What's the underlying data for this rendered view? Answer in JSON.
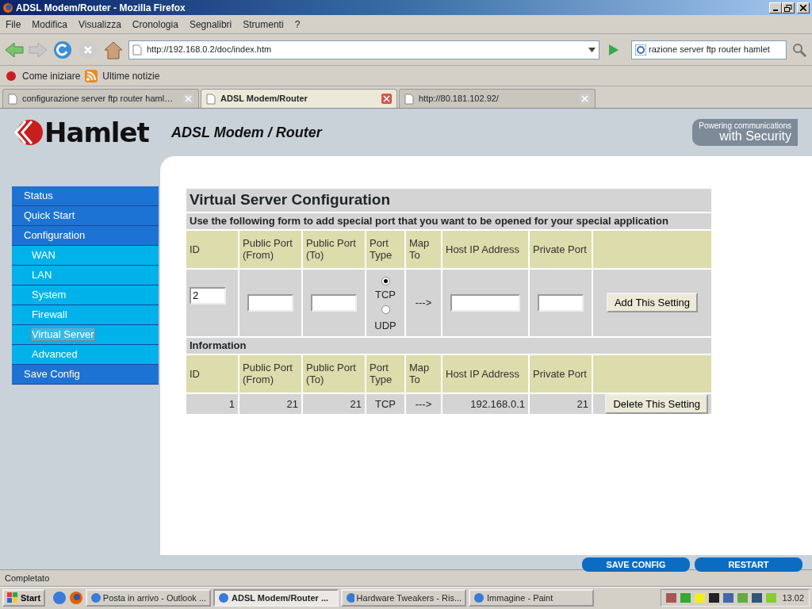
{
  "window": {
    "title": "ADSL Modem/Router - Mozilla Firefox"
  },
  "menu": [
    "File",
    "Modifica",
    "Visualizza",
    "Cronologia",
    "Segnalibri",
    "Strumenti",
    "?"
  ],
  "toolbar": {
    "url": "http://192.168.0.2/doc/index.htm",
    "search": "razione  server ftp router hamlet"
  },
  "bookmarks": [
    "Come iniziare",
    "Ultime notizie"
  ],
  "tabs": [
    {
      "label": "configurazione server ftp router haml…",
      "selected": false
    },
    {
      "label": "ADSL Modem/Router",
      "selected": true
    },
    {
      "label": "http://80.181.102.92/",
      "selected": false
    }
  ],
  "page": {
    "logo": "Hamlet",
    "header": "ADSL Modem / Router",
    "tagline": [
      "Powering communications",
      "with Security"
    ],
    "sidebar": [
      {
        "label": "Status",
        "kind": "main",
        "selected": false
      },
      {
        "label": "Quick Start",
        "kind": "main",
        "selected": false
      },
      {
        "label": "Configuration",
        "kind": "main",
        "selected": false
      },
      {
        "label": "WAN",
        "kind": "sub",
        "selected": false
      },
      {
        "label": "LAN",
        "kind": "sub",
        "selected": false
      },
      {
        "label": "System",
        "kind": "sub",
        "selected": false
      },
      {
        "label": "Firewall",
        "kind": "sub",
        "selected": false
      },
      {
        "label": "Virtual Server",
        "kind": "sub",
        "selected": true
      },
      {
        "label": "Advanced",
        "kind": "sub",
        "selected": false
      },
      {
        "label": "Save Config",
        "kind": "main",
        "selected": false
      }
    ],
    "form": {
      "title": "Virtual Server Configuration",
      "description": "Use the following form to add special port that you want to be opened for your special application",
      "columns": [
        "ID",
        "Public Port (From)",
        "Public Port (To)",
        "Port Type",
        "Map To",
        "Host IP Address",
        "Private Port"
      ],
      "id_value": "2",
      "port_types": [
        {
          "label": "TCP",
          "selected": true
        },
        {
          "label": "UDP",
          "selected": false
        }
      ],
      "map": "--->",
      "button": "Add This Setting"
    },
    "info": {
      "title": "Information",
      "columns": [
        "ID",
        "Public Port (From)",
        "Public Port (To)",
        "Port Type",
        "Map To",
        "Host IP Address",
        "Private Port"
      ],
      "rows": [
        {
          "cells": [
            "1",
            "21",
            "21",
            "TCP",
            "--->",
            "192.168.0.1",
            "21"
          ],
          "button": "Delete This Setting"
        }
      ]
    },
    "bottom_buttons": [
      "SAVE CONFIG",
      "RESTART"
    ]
  },
  "status_bar": "Completato",
  "taskbar": {
    "start": "Start",
    "items": [
      {
        "label": "Posta in arrivo - Outlook ...",
        "selected": false
      },
      {
        "label": "ADSL Modem/Router ...",
        "selected": true
      },
      {
        "label": "Hardware Tweakers - Ris...",
        "selected": false
      },
      {
        "label": "Immagine - Paint",
        "selected": false
      }
    ],
    "clock": "13.02"
  }
}
